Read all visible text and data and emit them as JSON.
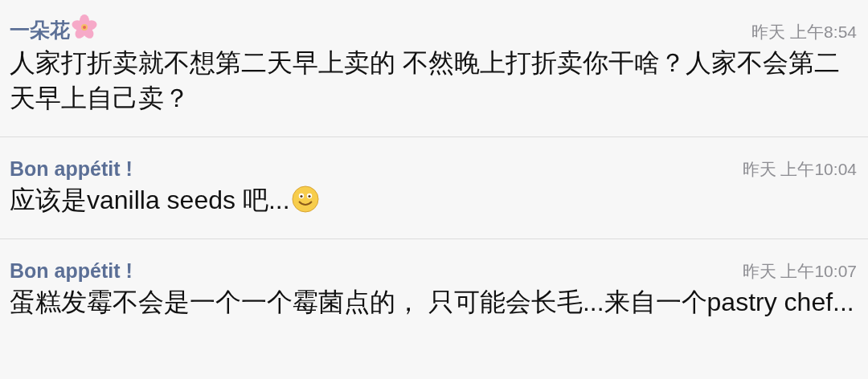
{
  "comments": [
    {
      "author": "一朵花",
      "author_emoji": {
        "kind": "flower"
      },
      "time": "昨天 上午8:54",
      "text": "人家打折卖就不想第二天早上卖的 不然晚上打折卖你干啥？人家不会第二天早上自己卖？"
    },
    {
      "author": "Bon appétit !",
      "time": "昨天 上午10:04",
      "text": "应该是vanilla seeds 吧...",
      "text_emoji": {
        "kind": "smile"
      }
    },
    {
      "author": "Bon appétit !",
      "time": "昨天 上午10:07",
      "text": "蛋糕发霉不会是一个一个霉菌点的， 只可能会长毛...来自一个pastry chef..."
    }
  ]
}
